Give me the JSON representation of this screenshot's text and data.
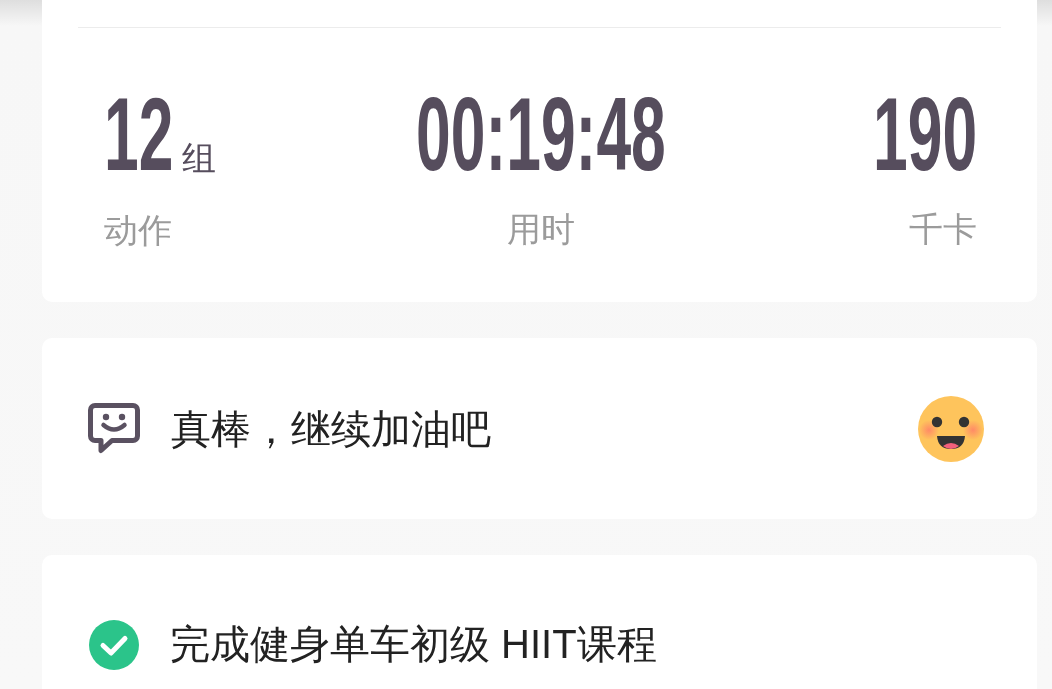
{
  "stats": [
    {
      "value": "12",
      "unit": "组",
      "label": "动作"
    },
    {
      "value": "00:19:48",
      "label": "用时"
    },
    {
      "value": "190",
      "label": "千卡"
    }
  ],
  "message": {
    "text": "真棒，继续加油吧"
  },
  "task": {
    "text": "完成健身单车初级 HIIT课程",
    "completed": true
  }
}
